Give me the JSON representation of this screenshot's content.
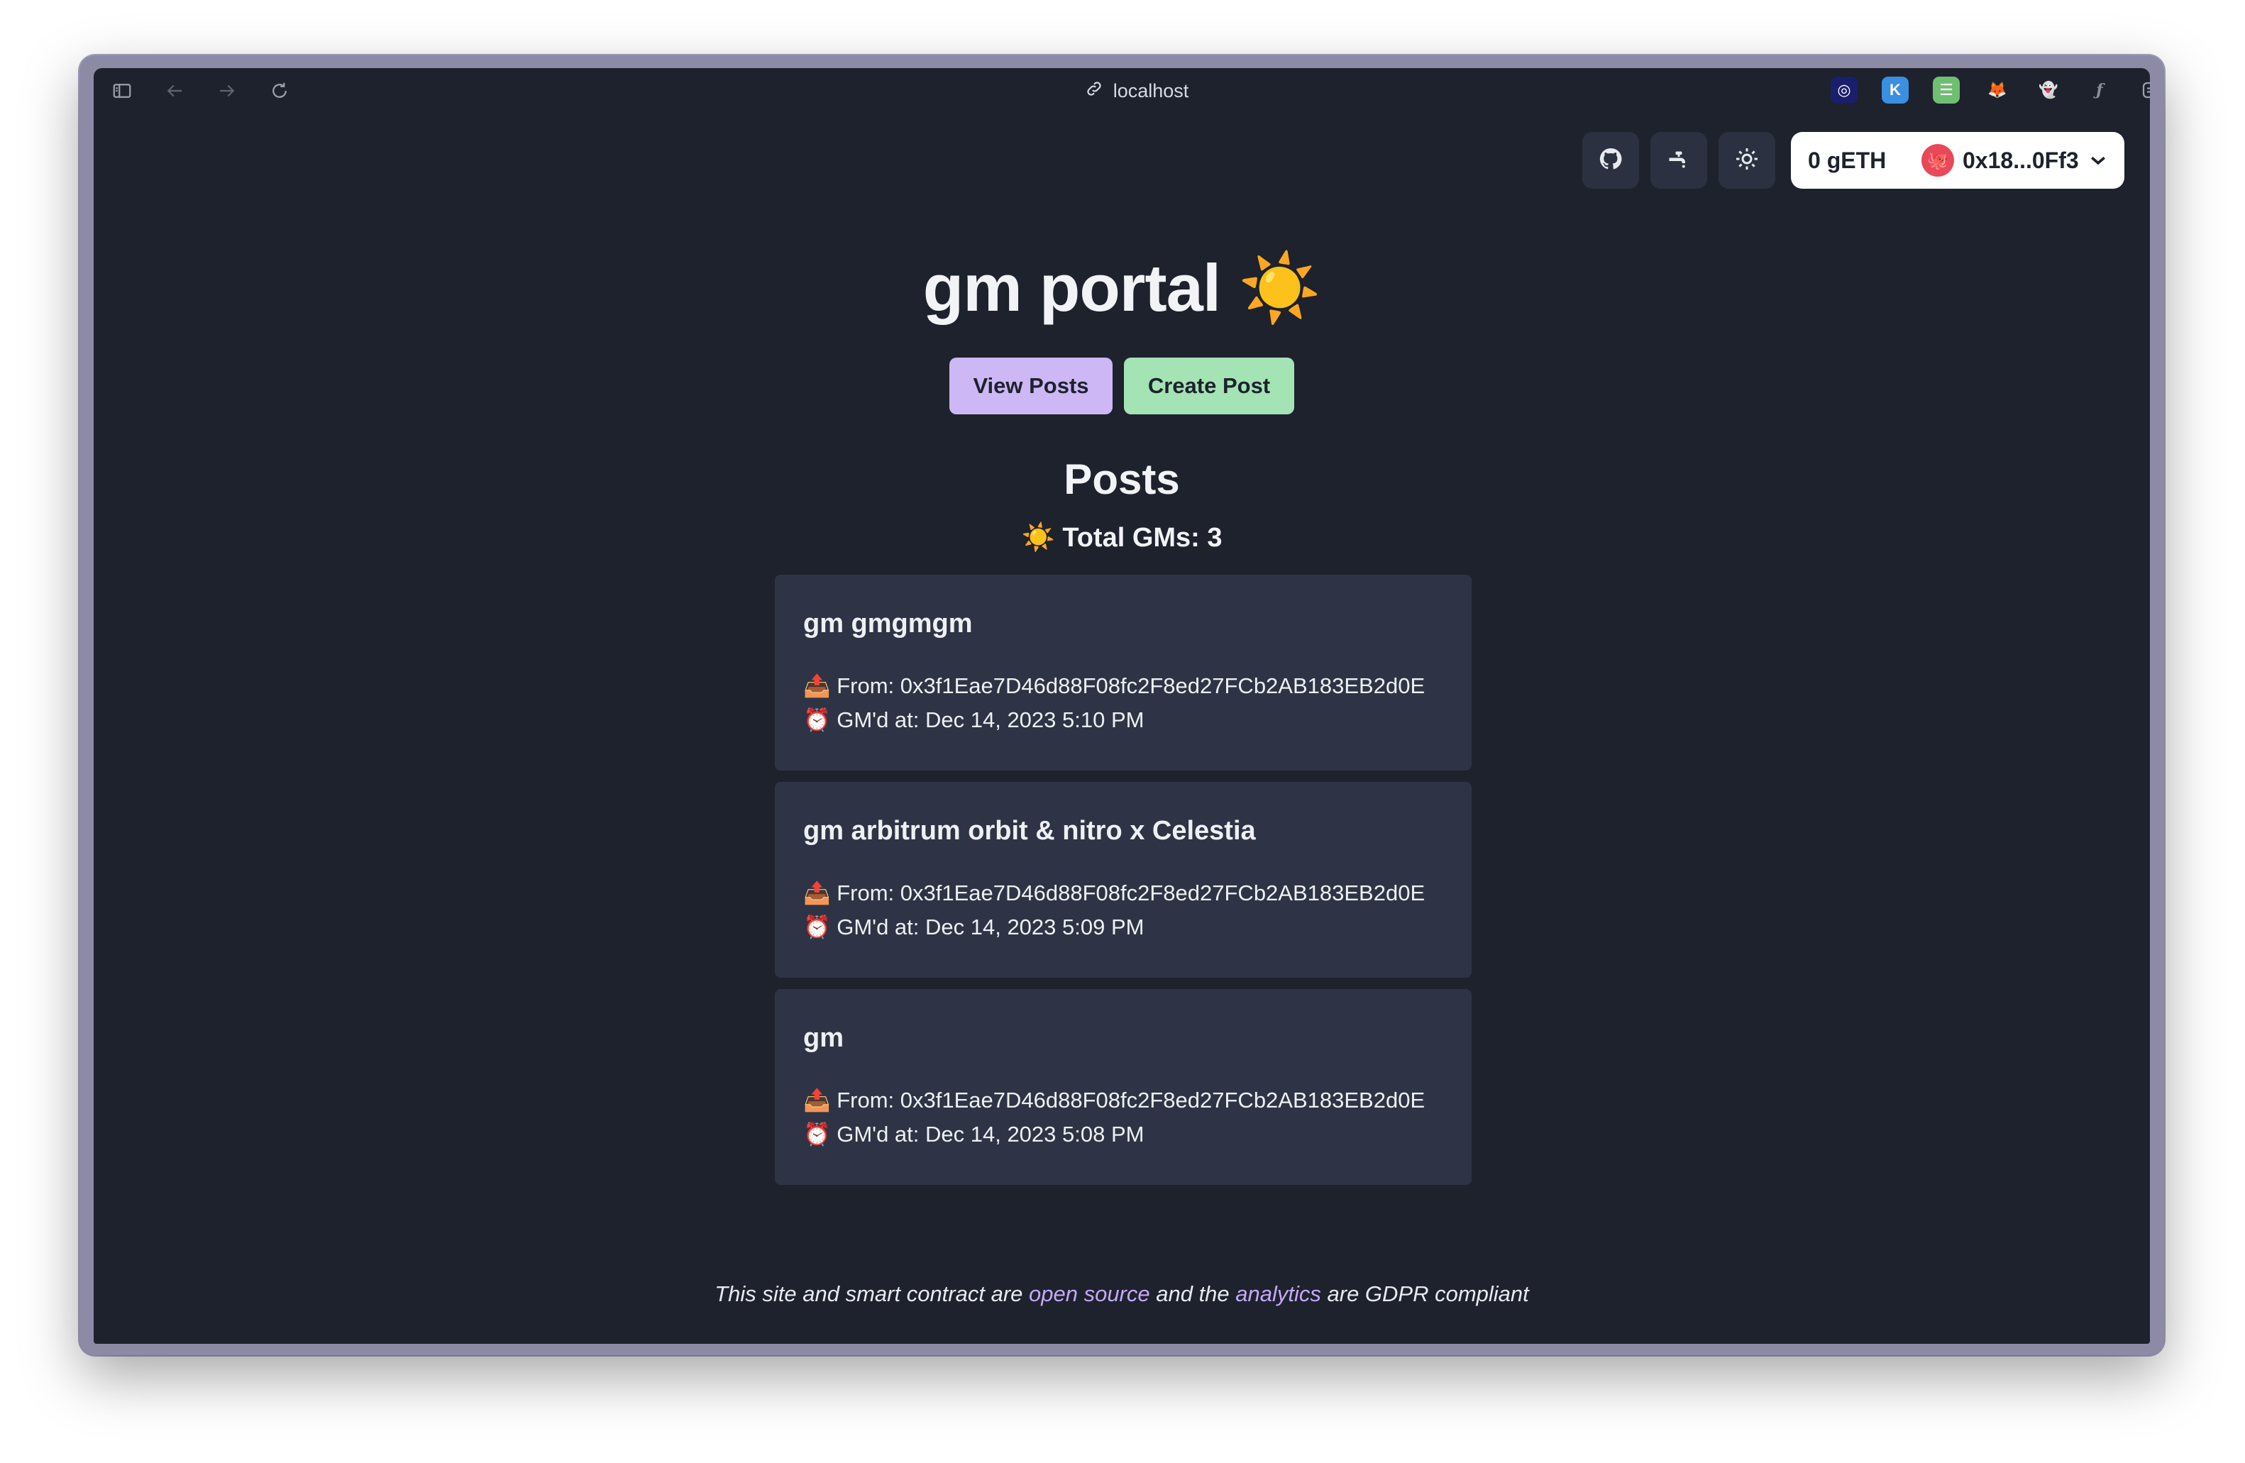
{
  "browser": {
    "url": "localhost",
    "toolbar_icons": [
      "sidebar-icon",
      "back-arrow-icon",
      "forward-arrow-icon",
      "reload-icon"
    ],
    "extensions": [
      {
        "name": "dark-circle-extension-icon",
        "bg": "#1a1f6b",
        "glyph": "◎"
      },
      {
        "name": "k-extension-icon",
        "bg": "#3a8fe0",
        "glyph": "K"
      },
      {
        "name": "stack-extension-icon",
        "bg": "#6fbf72",
        "glyph": "☰"
      },
      {
        "name": "metamask-fox-icon",
        "bg": "transparent",
        "glyph": "🦊"
      },
      {
        "name": "ghost-extension-icon",
        "bg": "transparent",
        "glyph": "👻"
      },
      {
        "name": "function-extension-icon",
        "bg": "transparent",
        "glyph": "ƒ"
      },
      {
        "name": "extensions-menu-icon",
        "bg": "transparent",
        "glyph": "⊜"
      },
      {
        "name": "split-view-icon",
        "bg": "transparent",
        "glyph": "◫"
      }
    ]
  },
  "header": {
    "icon_buttons": [
      "github-icon",
      "faucet-icon",
      "theme-toggle-icon"
    ],
    "wallet": {
      "balance": "0 gETH",
      "address": "0x18...0Ff3",
      "avatar_emoji": "🐙"
    }
  },
  "main": {
    "title": "gm portal ☀️",
    "buttons": {
      "view": "View Posts",
      "create": "Create Post"
    },
    "posts_heading": "Posts",
    "total_gms": "☀️ Total GMs: 3",
    "posts": [
      {
        "title": "gm gmgmgm",
        "from": "📤 From: 0x3f1Eae7D46d88F08fc2F8ed27FCb2AB183EB2d0E",
        "time": "⏰ GM'd at: Dec 14, 2023 5:10 PM"
      },
      {
        "title": "gm arbitrum orbit & nitro x Celestia",
        "from": "📤 From: 0x3f1Eae7D46d88F08fc2F8ed27FCb2AB183EB2d0E",
        "time": "⏰ GM'd at: Dec 14, 2023 5:09 PM"
      },
      {
        "title": "gm",
        "from": "📤 From: 0x3f1Eae7D46d88F08fc2F8ed27FCb2AB183EB2d0E",
        "time": "⏰ GM'd at: Dec 14, 2023 5:08 PM"
      }
    ]
  },
  "footer": {
    "text_1": "This site and smart contract are ",
    "link_1": "open source",
    "text_2": " and the ",
    "link_2": "analytics",
    "text_3": " are GDPR compliant"
  },
  "colors": {
    "page_bg": "#1d222d",
    "card_bg": "#2e3445",
    "view_button": "#cdb7f5",
    "create_button": "#a4e3b4",
    "link": "#c6a8f7"
  }
}
